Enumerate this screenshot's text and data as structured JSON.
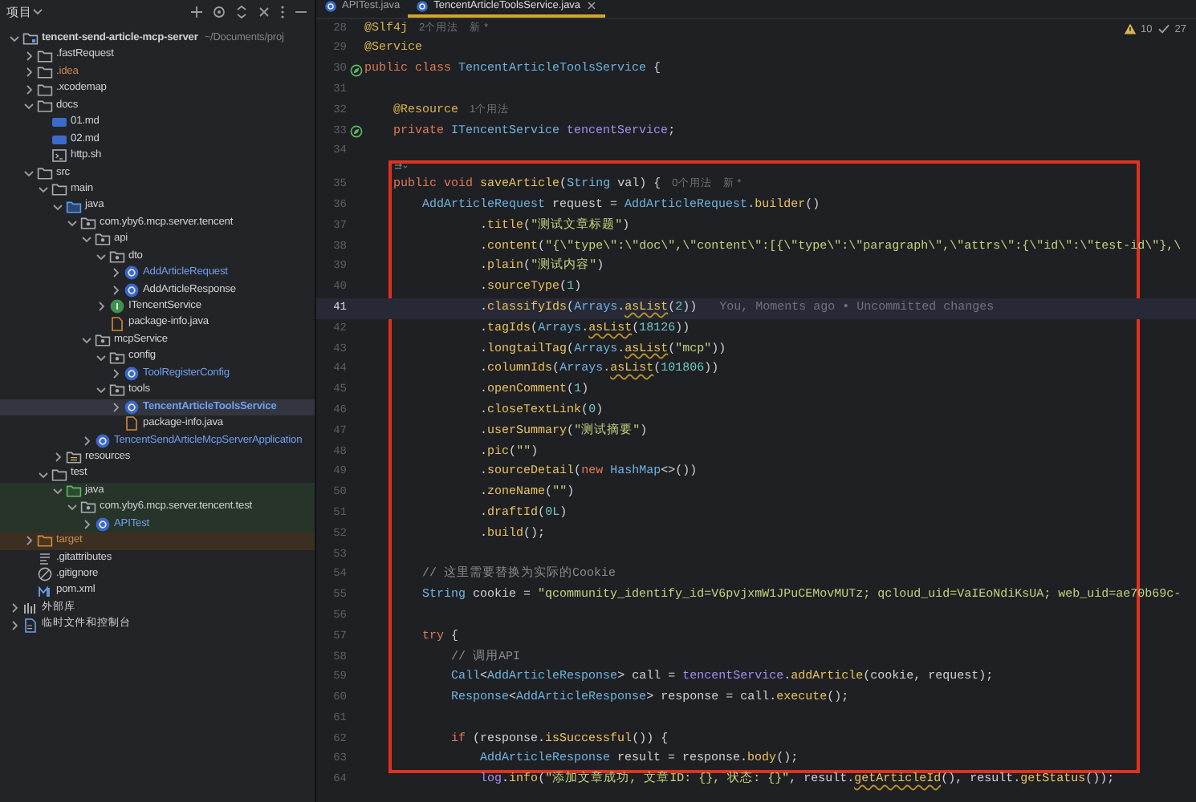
{
  "project_panel": {
    "title": "项目",
    "tree": [
      {
        "label": "tencent-send-article-mcp-server",
        "path": "~/Documents/proj",
        "kind": "module",
        "expanded": true,
        "selected": false,
        "children": [
          {
            "label": ".fastRequest",
            "kind": "folder",
            "expanded": false,
            "selected": false
          },
          {
            "label": ".idea",
            "kind": "folder",
            "color": "#c98a4a",
            "expanded": false,
            "selected": false
          },
          {
            "label": ".xcodemap",
            "kind": "folder",
            "expanded": false,
            "selected": false
          },
          {
            "label": "docs",
            "kind": "folder",
            "expanded": true,
            "selected": false,
            "children": [
              {
                "label": "01.md",
                "kind": "markdown",
                "selected": false
              },
              {
                "label": "02.md",
                "kind": "markdown",
                "selected": false
              },
              {
                "label": "http.sh",
                "kind": "shell",
                "selected": false
              }
            ]
          },
          {
            "label": "src",
            "kind": "folder",
            "expanded": true,
            "selected": false,
            "children": [
              {
                "label": "main",
                "kind": "folder",
                "expanded": true,
                "selected": false,
                "children": [
                  {
                    "label": "java",
                    "kind": "source-root",
                    "expanded": true,
                    "selected": false,
                    "children": [
                      {
                        "label": "com.yby6.mcp.server.tencent",
                        "kind": "package",
                        "expanded": true,
                        "selected": false,
                        "children": [
                          {
                            "label": "api",
                            "kind": "package",
                            "expanded": true,
                            "selected": false,
                            "children": [
                              {
                                "label": "dto",
                                "kind": "package",
                                "expanded": true,
                                "selected": false,
                                "children": [
                                  {
                                    "label": "AddArticleRequest",
                                    "kind": "class",
                                    "color": "#6f9fef",
                                    "expanded": false,
                                    "selected": false
                                  },
                                  {
                                    "label": "AddArticleResponse",
                                    "kind": "class",
                                    "expanded": false,
                                    "selected": false
                                  }
                                ]
                              },
                              {
                                "label": "ITencentService",
                                "kind": "interface",
                                "expanded": false,
                                "selected": false
                              },
                              {
                                "label": "package-info.java",
                                "kind": "java-file",
                                "selected": false
                              }
                            ]
                          },
                          {
                            "label": "mcpService",
                            "kind": "package",
                            "expanded": true,
                            "selected": false,
                            "children": [
                              {
                                "label": "config",
                                "kind": "package",
                                "expanded": true,
                                "selected": false,
                                "children": [
                                  {
                                    "label": "ToolRegisterConfig",
                                    "kind": "class",
                                    "color": "#6f9fef",
                                    "expanded": false,
                                    "selected": false
                                  }
                                ]
                              },
                              {
                                "label": "tools",
                                "kind": "package",
                                "expanded": true,
                                "selected": false,
                                "children": [
                                  {
                                    "label": "TencentArticleToolsService",
                                    "kind": "class",
                                    "color": "#6f9fef",
                                    "expanded": false,
                                    "selected": true
                                  },
                                  {
                                    "label": "package-info.java",
                                    "kind": "java-file",
                                    "selected": false
                                  }
                                ]
                              }
                            ]
                          },
                          {
                            "label": "TencentSendArticleMcpServerApplication",
                            "kind": "class",
                            "color": "#6f9fef",
                            "expanded": false,
                            "selected": false
                          }
                        ]
                      }
                    ]
                  },
                  {
                    "label": "resources",
                    "kind": "resources-root",
                    "expanded": false,
                    "selected": false
                  }
                ]
              },
              {
                "label": "test",
                "kind": "folder",
                "expanded": true,
                "selected": false,
                "children": [
                  {
                    "label": "java",
                    "kind": "test-root",
                    "expanded": true,
                    "selected": false,
                    "children": [
                      {
                        "label": "com.yby6.mcp.server.tencent.test",
                        "kind": "package",
                        "expanded": true,
                        "selected": false,
                        "children": [
                          {
                            "label": "APITest",
                            "kind": "class",
                            "color": "#6f9fef",
                            "expanded": false,
                            "selected": false
                          }
                        ]
                      }
                    ]
                  }
                ]
              }
            ]
          },
          {
            "label": "target",
            "kind": "excluded-folder",
            "color": "#c98a4a",
            "expanded": false,
            "selected": false
          },
          {
            "label": ".gitattributes",
            "kind": "text",
            "selected": false
          },
          {
            "label": ".gitignore",
            "kind": "ignore",
            "selected": false
          },
          {
            "label": "pom.xml",
            "kind": "maven",
            "selected": false
          }
        ]
      },
      {
        "label": "外部库",
        "kind": "library",
        "expanded": false,
        "selected": false
      },
      {
        "label": "临时文件和控制台",
        "kind": "scratch",
        "expanded": false,
        "selected": false
      }
    ]
  },
  "editor": {
    "tabs": [
      {
        "label": "APITest.java",
        "selected": false
      },
      {
        "label": "TencentArticleToolsService.java",
        "selected": true
      }
    ],
    "inspections": [
      {
        "kind": "warning",
        "count": "10"
      },
      {
        "kind": "ok",
        "count": "27"
      }
    ],
    "lines": [
      {
        "number": "28",
        "current": false,
        "boxed": false,
        "segments": [
          {
            "kind": "annotation",
            "text": "@Slf4j"
          },
          {
            "kind": "hint",
            "text": "2个用法"
          },
          {
            "kind": "hint",
            "text": "新 *"
          }
        ]
      },
      {
        "number": "29",
        "current": false,
        "boxed": false,
        "segments": [
          {
            "kind": "annotation",
            "text": "@Service"
          }
        ]
      },
      {
        "number": "30",
        "current": false,
        "boxed": false,
        "gutter_marker": true,
        "segments": [
          {
            "kind": "keyword",
            "text": "public class "
          },
          {
            "kind": "type",
            "text": "TencentArticleToolsService"
          },
          {
            "kind": "plain",
            "text": " {"
          }
        ]
      },
      {
        "number": "31",
        "current": false,
        "boxed": false
      },
      {
        "number": "32",
        "current": false,
        "boxed": false,
        "segments": [
          {
            "kind": "annotation",
            "text": "    @Resource"
          },
          {
            "kind": "hint",
            "text": "1个用法"
          }
        ]
      },
      {
        "number": "33",
        "current": false,
        "boxed": false,
        "gutter_marker": true,
        "segments": [
          {
            "kind": "keyword",
            "text": "    private "
          },
          {
            "kind": "type",
            "text": "ITencentService"
          },
          {
            "kind": "field",
            "text": " tencentService"
          },
          {
            "kind": "plain",
            "text": ";"
          }
        ]
      },
      {
        "number": "34",
        "current": false,
        "boxed": false
      },
      {
        "number": "35",
        "current": false,
        "boxed": true,
        "inlay_above": true,
        "segments": [
          {
            "kind": "keyword",
            "text": "    public void "
          },
          {
            "kind": "method",
            "text": "saveArticle"
          },
          {
            "kind": "plain",
            "text": "("
          },
          {
            "kind": "type",
            "text": "String"
          },
          {
            "kind": "plain",
            "text": " val) {"
          },
          {
            "kind": "hint",
            "text": "0个用法"
          },
          {
            "kind": "hint",
            "text": "新 *"
          }
        ]
      },
      {
        "number": "36",
        "current": false,
        "boxed": true,
        "segments": [
          {
            "kind": "type",
            "text": "        AddArticleRequest"
          },
          {
            "kind": "plain",
            "text": " request = "
          },
          {
            "kind": "type",
            "text": "AddArticleRequest"
          },
          {
            "kind": "plain",
            "text": "."
          },
          {
            "kind": "method",
            "text": "builder"
          },
          {
            "kind": "plain",
            "text": "()"
          }
        ]
      },
      {
        "number": "37",
        "current": false,
        "boxed": true,
        "segments": [
          {
            "kind": "plain",
            "text": "                ."
          },
          {
            "kind": "method",
            "text": "title"
          },
          {
            "kind": "plain",
            "text": "("
          },
          {
            "kind": "string",
            "text": "\"测试文章标题\""
          },
          {
            "kind": "plain",
            "text": ")"
          }
        ]
      },
      {
        "number": "38",
        "current": false,
        "boxed": true,
        "segments": [
          {
            "kind": "plain",
            "text": "                ."
          },
          {
            "kind": "method",
            "text": "content"
          },
          {
            "kind": "plain",
            "text": "("
          },
          {
            "kind": "string",
            "text": "\"{\\\"type\\\":\\\"doc\\\",\\\"content\\\":[{\\\"type\\\":\\\"paragraph\\\",\\\"attrs\\\":{\\\"id\\\":\\\"test-id\\\"},\\"
          }
        ]
      },
      {
        "number": "39",
        "current": false,
        "boxed": true,
        "segments": [
          {
            "kind": "plain",
            "text": "                ."
          },
          {
            "kind": "method",
            "text": "plain"
          },
          {
            "kind": "plain",
            "text": "("
          },
          {
            "kind": "string",
            "text": "\"测试内容\""
          },
          {
            "kind": "plain",
            "text": ")"
          }
        ]
      },
      {
        "number": "40",
        "current": false,
        "boxed": true,
        "segments": [
          {
            "kind": "plain",
            "text": "                ."
          },
          {
            "kind": "method",
            "text": "sourceType"
          },
          {
            "kind": "plain",
            "text": "("
          },
          {
            "kind": "number",
            "text": "1"
          },
          {
            "kind": "plain",
            "text": ")"
          }
        ]
      },
      {
        "number": "41",
        "current": true,
        "boxed": true,
        "segments": [
          {
            "kind": "plain",
            "text": "                ."
          },
          {
            "kind": "method",
            "text": "classifyIds"
          },
          {
            "kind": "plain",
            "text": "("
          },
          {
            "kind": "type",
            "text": "Arrays"
          },
          {
            "kind": "plain",
            "text": "."
          },
          {
            "kind": "warn-method",
            "text": "asList"
          },
          {
            "kind": "plain",
            "text": "("
          },
          {
            "kind": "number",
            "text": "2"
          },
          {
            "kind": "plain",
            "text": "))"
          },
          {
            "kind": "blame",
            "text": "You, Moments ago • Uncommitted changes"
          }
        ]
      },
      {
        "number": "42",
        "current": false,
        "boxed": true,
        "segments": [
          {
            "kind": "plain",
            "text": "                ."
          },
          {
            "kind": "method",
            "text": "tagIds"
          },
          {
            "kind": "plain",
            "text": "("
          },
          {
            "kind": "type",
            "text": "Arrays"
          },
          {
            "kind": "plain",
            "text": "."
          },
          {
            "kind": "warn-method",
            "text": "asList"
          },
          {
            "kind": "plain",
            "text": "("
          },
          {
            "kind": "number",
            "text": "18126"
          },
          {
            "kind": "plain",
            "text": "))"
          }
        ]
      },
      {
        "number": "43",
        "current": false,
        "boxed": true,
        "segments": [
          {
            "kind": "plain",
            "text": "                ."
          },
          {
            "kind": "method",
            "text": "longtailTag"
          },
          {
            "kind": "plain",
            "text": "("
          },
          {
            "kind": "type",
            "text": "Arrays"
          },
          {
            "kind": "plain",
            "text": "."
          },
          {
            "kind": "warn-method",
            "text": "asList"
          },
          {
            "kind": "plain",
            "text": "("
          },
          {
            "kind": "string",
            "text": "\"mcp\""
          },
          {
            "kind": "plain",
            "text": "))"
          }
        ]
      },
      {
        "number": "44",
        "current": false,
        "boxed": true,
        "segments": [
          {
            "kind": "plain",
            "text": "                ."
          },
          {
            "kind": "method",
            "text": "columnIds"
          },
          {
            "kind": "plain",
            "text": "("
          },
          {
            "kind": "type",
            "text": "Arrays"
          },
          {
            "kind": "plain",
            "text": "."
          },
          {
            "kind": "warn-method",
            "text": "asList"
          },
          {
            "kind": "plain",
            "text": "("
          },
          {
            "kind": "number",
            "text": "101806"
          },
          {
            "kind": "plain",
            "text": "))"
          }
        ]
      },
      {
        "number": "45",
        "current": false,
        "boxed": true,
        "segments": [
          {
            "kind": "plain",
            "text": "                ."
          },
          {
            "kind": "method",
            "text": "openComment"
          },
          {
            "kind": "plain",
            "text": "("
          },
          {
            "kind": "number",
            "text": "1"
          },
          {
            "kind": "plain",
            "text": ")"
          }
        ]
      },
      {
        "number": "46",
        "current": false,
        "boxed": true,
        "segments": [
          {
            "kind": "plain",
            "text": "                ."
          },
          {
            "kind": "method",
            "text": "closeTextLink"
          },
          {
            "kind": "plain",
            "text": "("
          },
          {
            "kind": "number",
            "text": "0"
          },
          {
            "kind": "plain",
            "text": ")"
          }
        ]
      },
      {
        "number": "47",
        "current": false,
        "boxed": true,
        "segments": [
          {
            "kind": "plain",
            "text": "                ."
          },
          {
            "kind": "method",
            "text": "userSummary"
          },
          {
            "kind": "plain",
            "text": "("
          },
          {
            "kind": "string",
            "text": "\"测试摘要\""
          },
          {
            "kind": "plain",
            "text": ")"
          }
        ]
      },
      {
        "number": "48",
        "current": false,
        "boxed": true,
        "segments": [
          {
            "kind": "plain",
            "text": "                ."
          },
          {
            "kind": "method",
            "text": "pic"
          },
          {
            "kind": "plain",
            "text": "("
          },
          {
            "kind": "string",
            "text": "\"\""
          },
          {
            "kind": "plain",
            "text": ")"
          }
        ]
      },
      {
        "number": "49",
        "current": false,
        "boxed": true,
        "segments": [
          {
            "kind": "plain",
            "text": "                ."
          },
          {
            "kind": "method",
            "text": "sourceDetail"
          },
          {
            "kind": "plain",
            "text": "("
          },
          {
            "kind": "keyword",
            "text": "new "
          },
          {
            "kind": "type",
            "text": "HashMap"
          },
          {
            "kind": "plain",
            "text": "<>())"
          }
        ]
      },
      {
        "number": "50",
        "current": false,
        "boxed": true,
        "segments": [
          {
            "kind": "plain",
            "text": "                ."
          },
          {
            "kind": "method",
            "text": "zoneName"
          },
          {
            "kind": "plain",
            "text": "("
          },
          {
            "kind": "string",
            "text": "\"\""
          },
          {
            "kind": "plain",
            "text": ")"
          }
        ]
      },
      {
        "number": "51",
        "current": false,
        "boxed": true,
        "segments": [
          {
            "kind": "plain",
            "text": "                ."
          },
          {
            "kind": "method",
            "text": "draftId"
          },
          {
            "kind": "plain",
            "text": "("
          },
          {
            "kind": "number",
            "text": "0L"
          },
          {
            "kind": "plain",
            "text": ")"
          }
        ]
      },
      {
        "number": "52",
        "current": false,
        "boxed": true,
        "segments": [
          {
            "kind": "plain",
            "text": "                ."
          },
          {
            "kind": "method",
            "text": "build"
          },
          {
            "kind": "plain",
            "text": "();"
          }
        ]
      },
      {
        "number": "53",
        "current": false,
        "boxed": true
      },
      {
        "number": "54",
        "current": false,
        "boxed": true,
        "segments": [
          {
            "kind": "comment",
            "text": "        // 这里需要替换为实际的Cookie"
          }
        ]
      },
      {
        "number": "55",
        "current": false,
        "boxed": true,
        "segments": [
          {
            "kind": "type",
            "text": "        String"
          },
          {
            "kind": "plain",
            "text": " cookie = "
          },
          {
            "kind": "string",
            "text": "\"qcommunity_identify_id=V6pvjxmW1JPuCEMovMUTz; qcloud_uid=VaIEoNdiKsUA; web_uid=ae70b69c-"
          }
        ]
      },
      {
        "number": "56",
        "current": false,
        "boxed": true
      },
      {
        "number": "57",
        "current": false,
        "boxed": true,
        "segments": [
          {
            "kind": "keyword",
            "text": "        try"
          },
          {
            "kind": "plain",
            "text": " {"
          }
        ]
      },
      {
        "number": "58",
        "current": false,
        "boxed": true,
        "segments": [
          {
            "kind": "comment",
            "text": "            // 调用API"
          }
        ]
      },
      {
        "number": "59",
        "current": false,
        "boxed": true,
        "segments": [
          {
            "kind": "type",
            "text": "            Call"
          },
          {
            "kind": "plain",
            "text": "<"
          },
          {
            "kind": "type",
            "text": "AddArticleResponse"
          },
          {
            "kind": "plain",
            "text": "> call = "
          },
          {
            "kind": "field",
            "text": "tencentService"
          },
          {
            "kind": "plain",
            "text": "."
          },
          {
            "kind": "method",
            "text": "addArticle"
          },
          {
            "kind": "plain",
            "text": "(cookie, request);"
          }
        ]
      },
      {
        "number": "60",
        "current": false,
        "boxed": true,
        "segments": [
          {
            "kind": "type",
            "text": "            Response"
          },
          {
            "kind": "plain",
            "text": "<"
          },
          {
            "kind": "type",
            "text": "AddArticleResponse"
          },
          {
            "kind": "plain",
            "text": "> response = call."
          },
          {
            "kind": "method",
            "text": "execute"
          },
          {
            "kind": "plain",
            "text": "();"
          }
        ]
      },
      {
        "number": "61",
        "current": false,
        "boxed": true
      },
      {
        "number": "62",
        "current": false,
        "boxed": true,
        "segments": [
          {
            "kind": "keyword",
            "text": "            if"
          },
          {
            "kind": "plain",
            "text": " (response."
          },
          {
            "kind": "method",
            "text": "isSuccessful"
          },
          {
            "kind": "plain",
            "text": "()) {"
          }
        ]
      },
      {
        "number": "63",
        "current": false,
        "boxed": true,
        "segments": [
          {
            "kind": "type",
            "text": "                AddArticleResponse"
          },
          {
            "kind": "plain",
            "text": " result = response."
          },
          {
            "kind": "method",
            "text": "body"
          },
          {
            "kind": "plain",
            "text": "();"
          }
        ]
      },
      {
        "number": "64",
        "current": false,
        "boxed": false,
        "segments": [
          {
            "kind": "field",
            "text": "                log"
          },
          {
            "kind": "plain",
            "text": "."
          },
          {
            "kind": "method",
            "text": "info"
          },
          {
            "kind": "plain",
            "text": "("
          },
          {
            "kind": "string",
            "text": "\"添加文章成功, 文章ID: {}, 状态: {}\""
          },
          {
            "kind": "plain",
            "text": ", result."
          },
          {
            "kind": "warn-method",
            "text": "getArticleId"
          },
          {
            "kind": "plain",
            "text": "(), result."
          },
          {
            "kind": "method",
            "text": "getStatus"
          },
          {
            "kind": "plain",
            "text": "());"
          }
        ]
      }
    ]
  }
}
